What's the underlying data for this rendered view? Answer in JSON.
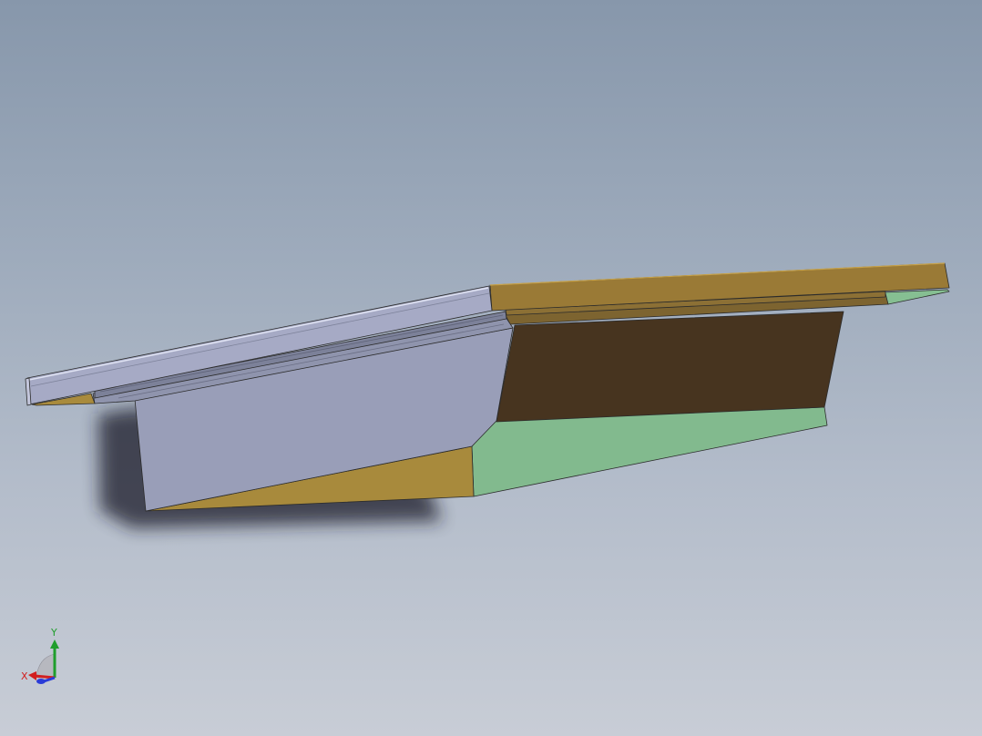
{
  "viewport": {
    "background_top": "#8797ab",
    "background_bottom": "#c8cdd6"
  },
  "model": {
    "colors": {
      "left_face": "#9a9fb8",
      "top_rail": "#a7abc6",
      "tan_top": "#9a7a36",
      "tan_bottom": "#a88a3c",
      "dark_brown": "#47341f",
      "green": "#82ba8e",
      "edge": "#2b2b2b"
    }
  },
  "triad": {
    "x_label": "X",
    "y_label": "Y",
    "x_color": "#d21e1e",
    "y_color": "#1f9e2c",
    "z_color": "#2a3cd8"
  }
}
